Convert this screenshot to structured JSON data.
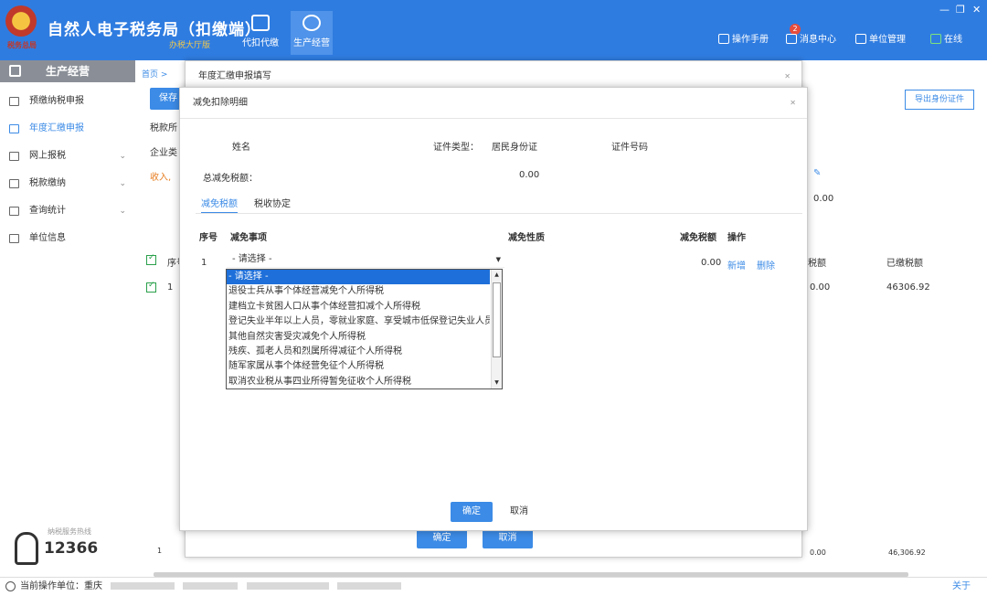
{
  "app": {
    "title": "自然人电子税务局（扣缴端）",
    "subtitle": "办税大厅版",
    "emblem_text": "税务总局"
  },
  "nav": [
    {
      "label": "代扣代缴",
      "icon": "wallet-icon"
    },
    {
      "label": "生产经营",
      "icon": "coins-icon"
    }
  ],
  "header_links": {
    "manual": "操作手册",
    "messages": "消息中心",
    "message_count": "2",
    "org": "单位管理",
    "status": "在线"
  },
  "window_controls": {
    "minimize": "—",
    "restore": "❐",
    "close": "✕"
  },
  "sidebar": {
    "title": "生产经营",
    "items": [
      {
        "label": "预缴纳税申报",
        "expandable": false
      },
      {
        "label": "年度汇缴申报",
        "expandable": false
      },
      {
        "label": "网上报税",
        "expandable": true
      },
      {
        "label": "税款缴纳",
        "expandable": true
      },
      {
        "label": "查询统计",
        "expandable": true
      },
      {
        "label": "单位信息",
        "expandable": false
      }
    ],
    "hotline": "12366",
    "hotline_caption": "纳税服务热线"
  },
  "background": {
    "breadcrumb": "首页 >",
    "save_btn": "保存",
    "row1": "税款所",
    "row2": "企业类",
    "row3": "收入,",
    "right_btn": "导出身份证件",
    "col_seq": "序号",
    "col_tax": "税额",
    "col_paid": "已缴税额",
    "row_seq": "1",
    "row_tax": "0.00",
    "row_paid": "46306.92",
    "val_000": "0.00",
    "bottom_left": "1",
    "bottom_tax": "0.00",
    "bottom_paid": "46,306.92"
  },
  "modal_outer": {
    "title": "年度汇缴申报填写",
    "confirm": "确定",
    "cancel": "取消"
  },
  "modal_inner": {
    "title": "减免扣除明细",
    "name_label": "姓名",
    "id_type_label": "证件类型：",
    "id_type_value": "居民身份证",
    "id_no_label": "证件号码",
    "total_label": "总减免税额：",
    "total_value": "0.00",
    "tabs": [
      "减免税额",
      "税收协定"
    ],
    "columns": {
      "seq": "序号",
      "item": "减免事项",
      "nature": "减免性质",
      "amount": "减免税额",
      "ops": "操作"
    },
    "row": {
      "seq": "1",
      "select_value": "- 请选择 -",
      "amount": "0.00",
      "add": "新增",
      "delete": "删除"
    },
    "dropdown_options": [
      "- 请选择 -",
      "退役士兵从事个体经营减免个人所得税",
      "建档立卡贫困人口从事个体经营扣减个人所得税",
      "登记失业半年以上人员，零就业家庭、享受城市低保登记失业人员",
      "其他自然灾害受灾减免个人所得税",
      "残疾、孤老人员和烈属所得减征个人所得税",
      "随军家属从事个体经营免征个人所得税",
      "取消农业税从事四业所得暂免征收个人所得税"
    ],
    "confirm": "确定",
    "cancel": "取消"
  },
  "footer": {
    "label": "当前操作单位：重庆",
    "about": "关于"
  },
  "colors": {
    "primary": "#2f7ce0",
    "accent": "#3c8be6",
    "selected": "#1e6fd9",
    "income": "#e67e22"
  }
}
